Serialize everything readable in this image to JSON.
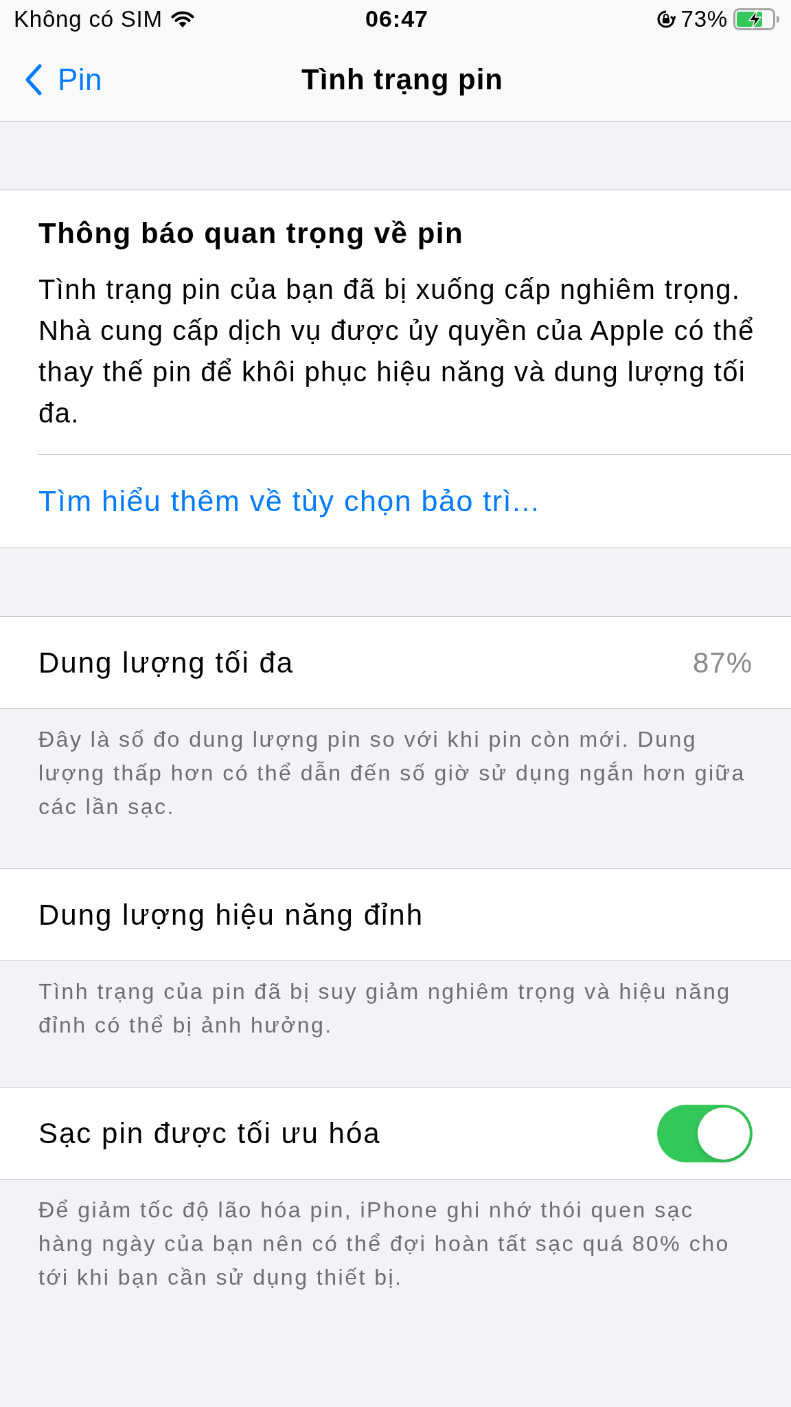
{
  "status_bar": {
    "carrier": "Không có SIM",
    "time": "06:47",
    "battery_percent": "73%"
  },
  "nav_bar": {
    "back_label": "Pin",
    "title": "Tình trạng pin"
  },
  "sections": [
    {
      "kind": "notice",
      "title": "Thông báo quan trọng về pin",
      "body": "Tình trạng pin của bạn đã bị xuống cấp nghiêm trọng. Nhà cung cấp dịch vụ được ủy quyền của Apple có thể thay thế pin để khôi phục hiệu năng và dung lượng tối đa.",
      "link": "Tìm hiểu thêm về tùy chọn bảo trì..."
    },
    {
      "kind": "value",
      "label": "Dung lượng tối đa",
      "value": "87%",
      "footer": "Đây là số đo dung lượng pin so với khi pin còn mới. Dung lượng thấp hơn có thể dẫn đến số giờ sử dụng ngắn hơn giữa các lần sạc."
    },
    {
      "kind": "plain",
      "label": "Dung lượng hiệu năng đỉnh",
      "footer": "Tình trạng của pin đã bị suy giảm nghiêm trọng và hiệu năng đỉnh có thể bị ảnh hưởng."
    },
    {
      "kind": "toggle",
      "label": "Sạc pin được tối ưu hóa",
      "on": true,
      "footer": "Để giảm tốc độ lão hóa pin, iPhone ghi nhớ thói quen sạc hàng ngày của bạn nên có thể đợi hoàn tất sạc quá 80% cho tới khi bạn cần sử dụng thiết bị."
    }
  ]
}
